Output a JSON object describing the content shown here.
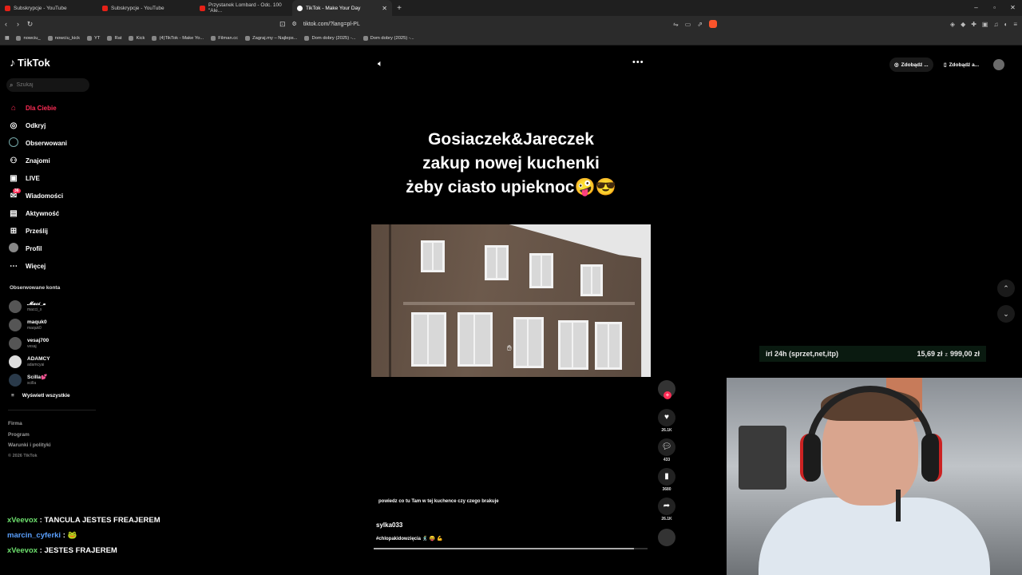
{
  "browser": {
    "tabs": [
      {
        "title": "Subskrypcje - YouTube",
        "active": false,
        "favicon": "youtube-icon"
      },
      {
        "title": "Subskrypcje - YouTube",
        "active": false,
        "favicon": "youtube-icon"
      },
      {
        "title": "Przystanek Lombard - Odc. 100 \"Ale...",
        "active": false,
        "favicon": "youtube-icon"
      },
      {
        "title": "TikTok - Make Your Day",
        "active": true,
        "favicon": "tiktok-icon"
      }
    ],
    "url": "tiktok.com/?lang=pl-PL",
    "bookmarks": [
      "nowciu_",
      "nowciu_kick",
      "YT",
      "Rat",
      "Kick",
      "(4)TikTok - Make Yo...",
      "Filman.cc",
      "Zagraj.my – Najleps...",
      "Dom dobry (2025) -...",
      "Dom dobry (2025) -..."
    ]
  },
  "tiktok": {
    "logo": "TikTok",
    "search_placeholder": "Szukaj",
    "menu": [
      {
        "label": "Dla Ciebie",
        "icon": "home-icon",
        "active": true
      },
      {
        "label": "Odkryj",
        "icon": "compass-icon"
      },
      {
        "label": "Obserwowani",
        "icon": "following-icon"
      },
      {
        "label": "Znajomi",
        "icon": "friends-icon"
      },
      {
        "label": "LIVE",
        "icon": "live-icon"
      },
      {
        "label": "Wiadomości",
        "icon": "messages-icon",
        "badge": "36"
      },
      {
        "label": "Aktywność",
        "icon": "activity-icon"
      },
      {
        "label": "Prześlij",
        "icon": "upload-icon"
      },
      {
        "label": "Profil",
        "icon": "profile-avatar-icon"
      },
      {
        "label": "Więcej",
        "icon": "more-dots-icon"
      }
    ],
    "following_title": "Obserwowane konta",
    "following": [
      {
        "name": "𝓜𝓪𝓬𝓲_𝔁",
        "handle": "macci_x"
      },
      {
        "name": "maquk0",
        "handle": "maquk0"
      },
      {
        "name": "vesaj700",
        "handle": "vesaj"
      },
      {
        "name": "ADAMCY",
        "handle": "adamcyai"
      },
      {
        "name": "Scilla💕",
        "handle": "scilla"
      }
    ],
    "show_all": "Wyświetl wszystkie",
    "footer": [
      "Firma",
      "Program",
      "Warunki i polityki"
    ],
    "copyright": "© 2026 TikTok",
    "get_buttons": [
      "Zdobądź ...",
      "Zdobądź a..."
    ]
  },
  "video": {
    "caption_lines": [
      "Gosiaczek&Jareczek",
      "zakup nowej kuchenki",
      "żeby ciasto upieknoc🤪😎"
    ],
    "subtitle": "powiedz co tu Tam w tej kuchence czy czego brakuje",
    "author": "sylka033",
    "hashtags": "#chlopakidowzięcia 🕺 😝 💪",
    "progress": 0.95,
    "counts": {
      "likes": "26.1K",
      "comments": "433",
      "saves": "3680",
      "shares": "26.1K"
    }
  },
  "chat": [
    {
      "user": "xVeevox",
      "color": "#6ee06e",
      "text": "TANCULA JESTES FREAJEREM"
    },
    {
      "user": "marcin_cyferki",
      "color": "#5aa0ff",
      "text": "🐸"
    },
    {
      "user": "xVeevox",
      "color": "#6ee06e",
      "text": "JESTES FRAJEREM"
    }
  ],
  "stream_goal": {
    "label": "irl 24h (sprzet,net,itp)",
    "current": "15,69 zł",
    "separator": "z",
    "target": "999,00 zł"
  }
}
